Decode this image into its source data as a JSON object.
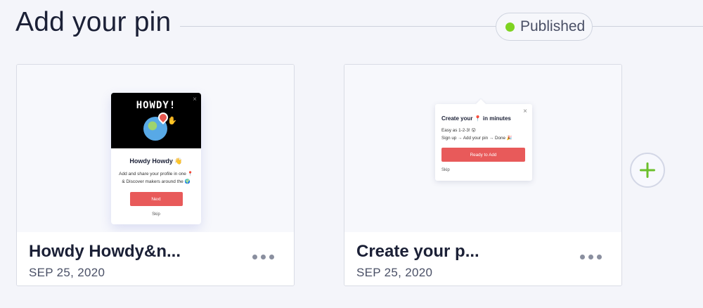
{
  "header": {
    "title": "Add your pin",
    "status": {
      "label": "Published",
      "color": "#7ed321"
    }
  },
  "cards": [
    {
      "title": "Howdy Howdy&n...",
      "date": "SEP 25, 2020",
      "more_icon": "more-horizontal-icon",
      "preview": {
        "logo_text": "HOWDY!",
        "close": "×",
        "heading": "Howdy Howdy 👋",
        "body_line1": "Add and share your profile in one 📍",
        "body_line2": "& Discover makers around the 🌍",
        "button": "Next",
        "skip": "Skip"
      }
    },
    {
      "title": "Create your p...",
      "date": "SEP 25, 2020",
      "more_icon": "more-horizontal-icon",
      "preview": {
        "close": "×",
        "heading": "Create your 📍 in minutes",
        "line1": "Easy as 1-2-3! 😮",
        "line2": "Sign up → Add your pin → Done 🎉",
        "button": "Ready to Add",
        "skip": "Skip"
      }
    }
  ],
  "add_button": {
    "icon": "plus-icon",
    "color": "#6bbf2a"
  }
}
